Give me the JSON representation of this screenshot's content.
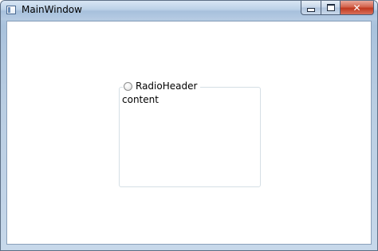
{
  "window": {
    "title": "MainWindow",
    "icon": "window-app-icon",
    "buttons": {
      "minimize": "minimize-icon",
      "maximize": "maximize-icon",
      "close_glyph": "✕"
    }
  },
  "groupbox": {
    "header_label": "RadioHeader",
    "radio_checked": false,
    "content_text": "content"
  },
  "colors": {
    "close_button": "#c0391f",
    "title_bar": "#bcd1e7",
    "group_border": "#d5dfe5"
  }
}
